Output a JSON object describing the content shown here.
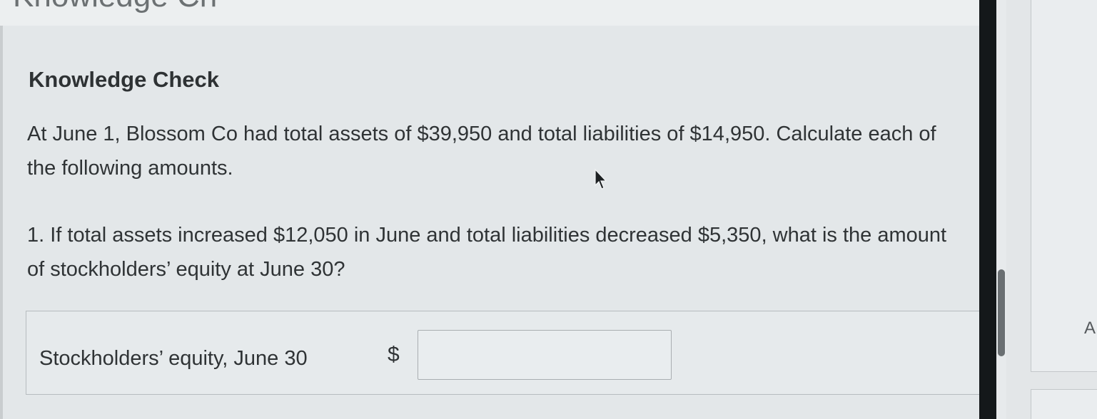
{
  "header": {
    "partial_title": "Knowledge Ch"
  },
  "card": {
    "title": "Knowledge Check",
    "intro": "At June 1, Blossom Co had total assets of $39,950 and total liabilities of $14,950. Calculate each of the following amounts.",
    "question": "1. If total assets increased $12,050 in June and total liabilities decreased $5,350, what is the amount of stockholders’ equity at June 30?"
  },
  "answer": {
    "label": "Stockholders’ equity, June 30",
    "currency_symbol": "$",
    "value": ""
  },
  "side": {
    "partial_text": "A"
  },
  "colors": {
    "text": "#2f3335",
    "background": "#e3e7e9",
    "bezel": "#14181a"
  },
  "icons": {
    "cursor": "mouse-pointer-icon"
  }
}
